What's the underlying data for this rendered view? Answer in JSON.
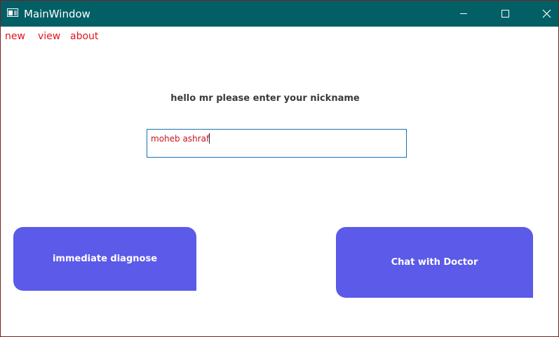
{
  "window": {
    "title": "MainWindow",
    "icon": "app-window-icon",
    "controls": {
      "minimize": "minimize-icon",
      "maximize": "maximize-icon",
      "close": "close-icon"
    }
  },
  "menu": {
    "items": [
      {
        "label": "new"
      },
      {
        "label": "view"
      },
      {
        "label": "about"
      }
    ]
  },
  "main": {
    "prompt": "hello mr please enter your nickname",
    "nickname_input": {
      "value": "moheb ashraf",
      "focused": true
    },
    "buttons": {
      "diagnose_label": "immediate diagnose",
      "chat_label": "Chat with Doctor"
    }
  },
  "colors": {
    "titlebar": "#015f65",
    "menu_text": "#e0141e",
    "input_text": "#c8141e",
    "input_border": "#1a6fb0",
    "button_bg": "#5c5ae8",
    "window_border": "#7a1f1f"
  }
}
